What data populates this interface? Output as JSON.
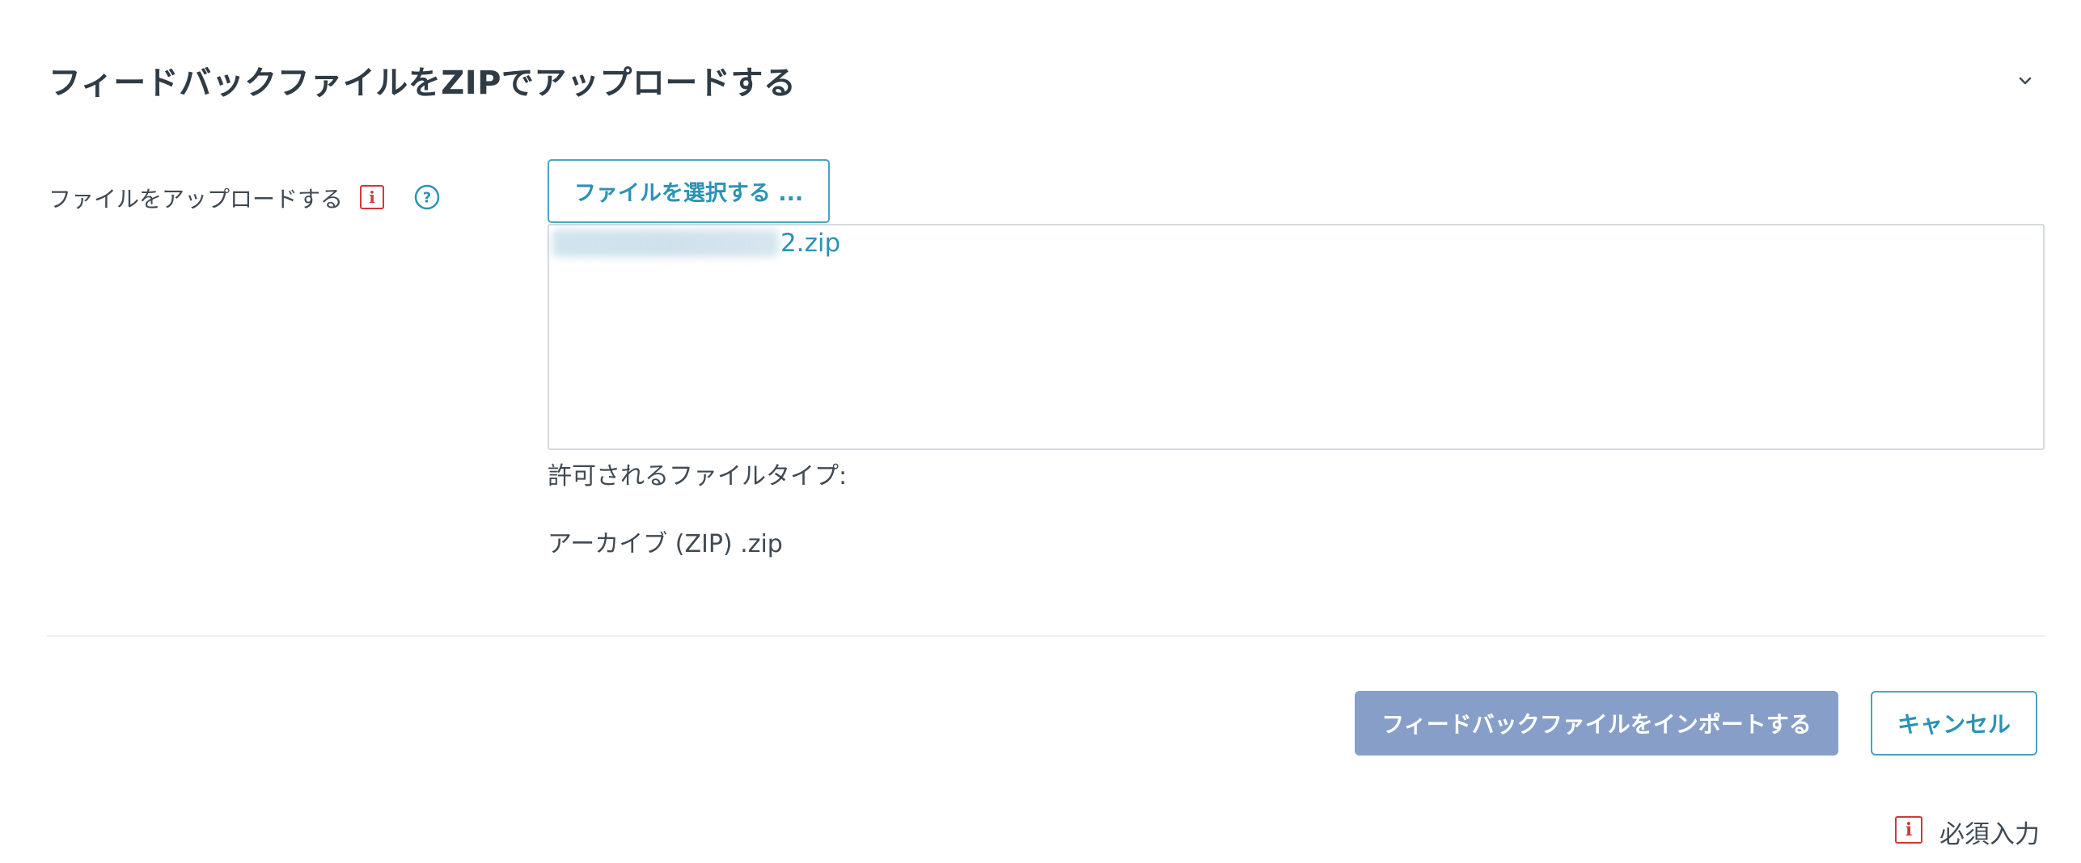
{
  "section": {
    "title": "フィードバックファイルをZIPでアップロードする",
    "toggle_icon": "chevron-down-icon"
  },
  "upload_field": {
    "label": "ファイルをアップロードする",
    "required_icon": "required-info-icon",
    "help_icon": "question-circle-icon",
    "choose_button_label": "ファイルを選択する ...",
    "selected_file_visible_suffix": "2.zip"
  },
  "allowed_types": {
    "title": "許可されるファイルタイプ:",
    "types": [
      "アーカイブ (ZIP) .zip"
    ]
  },
  "actions": {
    "import_label": "フィードバックファイルをインポートする",
    "cancel_label": "キャンセル"
  },
  "legend": {
    "required_label": "必須入力"
  },
  "colors": {
    "accent": "#2a93b6",
    "primary_disabled": "#879fc8",
    "required": "#d0393c",
    "text": "#404a54",
    "heading": "#2f3b45"
  }
}
